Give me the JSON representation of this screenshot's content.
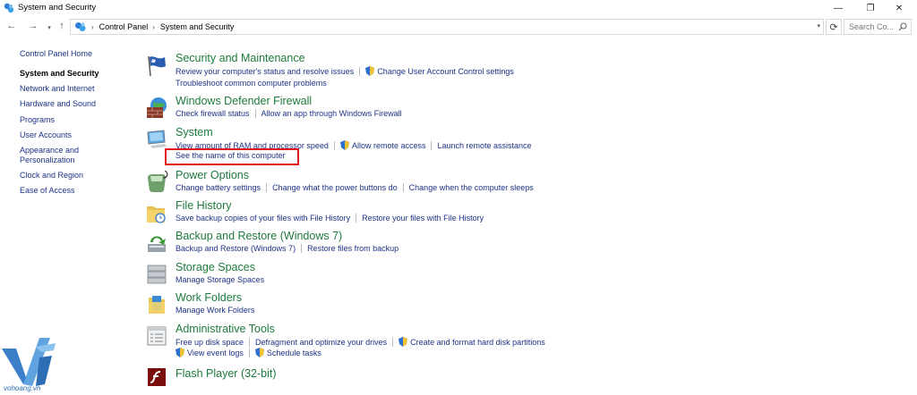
{
  "window": {
    "title": "System and Security",
    "minimize_glyph": "—",
    "maximize_glyph": "❐",
    "close_glyph": "✕"
  },
  "nav": {
    "back_glyph": "←",
    "forward_glyph": "→",
    "recent_glyph": "▾",
    "up_glyph": "↑",
    "refresh_glyph": "⟳"
  },
  "address": {
    "breadcrumbs": [
      "Control Panel",
      "System and Security"
    ],
    "separator": "›",
    "dropdown_glyph": "▾"
  },
  "search": {
    "placeholder": "Search Co..."
  },
  "sidebar": {
    "home": "Control Panel Home",
    "items": [
      {
        "label": "System and Security",
        "current": true
      },
      {
        "label": "Network and Internet"
      },
      {
        "label": "Hardware and Sound"
      },
      {
        "label": "Programs"
      },
      {
        "label": "User Accounts"
      },
      {
        "label": "Appearance and"
      },
      {
        "label": "Personalization"
      },
      {
        "label": "Clock and Region"
      },
      {
        "label": "Ease of Access"
      }
    ]
  },
  "categories": {
    "security": {
      "title": "Security and Maintenance",
      "link1": "Review your computer's status and resolve issues",
      "link2": "Change User Account Control settings",
      "link3": "Troubleshoot common computer problems",
      "icon": "flag-icon"
    },
    "firewall": {
      "title": "Windows Defender Firewall",
      "link1": "Check firewall status",
      "link2": "Allow an app through Windows Firewall",
      "icon": "firewall-icon"
    },
    "system": {
      "title": "System",
      "link1": "View amount of RAM and processor speed",
      "link2": "Allow remote access",
      "link3": "Launch remote assistance",
      "link4": "See the name of this computer",
      "icon": "computer-icon"
    },
    "power": {
      "title": "Power Options",
      "link1": "Change battery settings",
      "link2": "Change what the power buttons do",
      "link3": "Change when the computer sleeps",
      "icon": "power-icon"
    },
    "filehistory": {
      "title": "File History",
      "link1": "Save backup copies of your files with File History",
      "link2": "Restore your files with File History",
      "icon": "file-history-icon"
    },
    "backup": {
      "title": "Backup and Restore (Windows 7)",
      "link1": "Backup and Restore (Windows 7)",
      "link2": "Restore files from backup",
      "icon": "backup-icon"
    },
    "storage": {
      "title": "Storage Spaces",
      "link1": "Manage Storage Spaces",
      "icon": "storage-icon"
    },
    "workfolders": {
      "title": "Work Folders",
      "link1": "Manage Work Folders",
      "icon": "work-folders-icon"
    },
    "admin": {
      "title": "Administrative Tools",
      "link1": "Free up disk space",
      "link2": "Defragment and optimize your drives",
      "link3": "Create and format hard disk partitions",
      "link4": "View event logs",
      "link5": "Schedule tasks",
      "icon": "admin-tools-icon"
    },
    "flash": {
      "title": "Flash Player (32-bit)",
      "icon": "flash-icon"
    }
  },
  "watermark": {
    "text": "vohoang.vn"
  },
  "colors": {
    "link": "#1e3287",
    "category_title": "#1e7b3c",
    "highlight_box": "#e0161b"
  }
}
